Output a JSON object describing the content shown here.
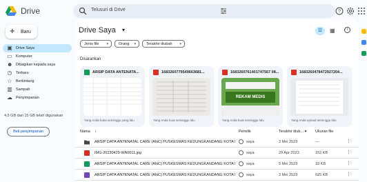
{
  "app": {
    "title": "Drive",
    "brand_colors": [
      "#4285f4",
      "#0f9d58",
      "#fbbc04"
    ]
  },
  "search": {
    "placeholder": "Telusuri di Drive",
    "icon": "search-icon"
  },
  "topbar": {
    "icons": [
      "tune-icon",
      "help-icon",
      "settings-icon",
      "apps-icon"
    ]
  },
  "sidebar": {
    "new_label": "Baru",
    "items": [
      {
        "label": "Drive Saya",
        "icon": "my-drive-icon",
        "active": true
      },
      {
        "label": "Komputer",
        "icon": "computer-icon"
      },
      {
        "label": "Dibagikan kepada saya",
        "icon": "shared-icon"
      },
      {
        "label": "Terbaru",
        "icon": "clock-icon"
      },
      {
        "label": "Berbintang",
        "icon": "star-icon"
      },
      {
        "label": "Sampah",
        "icon": "trash-icon"
      },
      {
        "label": "Penyimpanan",
        "icon": "cloud-icon"
      }
    ],
    "storage_text": "4,5 GB dari 15 GB telah digunakan",
    "storage_used_fraction": 0.3,
    "buy_label": "Beli penyimpanan"
  },
  "main": {
    "title": "Drive Saya",
    "filters": [
      "Jenis file",
      "Orang",
      "Terakhir diubah"
    ],
    "suggested_label": "Disarankan",
    "cards": [
      {
        "name": "ARSIP DATA ANTENATA...",
        "sub": "Yang Anda buka seminggu yang lalu",
        "type": "sheet",
        "color": "#0f9d58"
      },
      {
        "name": "1683260779549663681...",
        "sub": "Yang Anda buat seminggu lalu",
        "type": "image",
        "color": "#d93025"
      },
      {
        "name": "1683260761401747567 08...",
        "sub": "Yang Anda buat seminggu lalu",
        "type": "image",
        "color": "#d93025",
        "thumb_text": "REKAM MEDIS"
      },
      {
        "name": "1683260478472927204...",
        "sub": "Yang Anda upload seminggu lalu",
        "type": "image",
        "color": "#d93025"
      }
    ],
    "columns": {
      "name": "Nama",
      "owner": "Pemilik",
      "modified": "Terakhir diub...",
      "size": "Ukuran file"
    },
    "rows": [
      {
        "name": "ARSIP DATA ANTENATAL CARE (ANC) PUSKESMAS KEDUNGKANDANG KOTA M...",
        "owner": "saya",
        "date": "3 Mei 2023",
        "size": "—",
        "type": "folder",
        "color": "#444746"
      },
      {
        "name": "IMG-20230429-WA0011.jpg",
        "owner": "saya",
        "date": "29 Apr 2023",
        "size": "152 KB",
        "type": "image",
        "color": "#d93025"
      },
      {
        "name": "ARSIP DATA ANTENATAL CARE (ANC) PUSKESMAS KEDUNGKANDANG KOTA M...",
        "owner": "saya",
        "date": "5 Mei 2023",
        "size": "19 KB",
        "type": "sheet",
        "color": "#0f9d58"
      },
      {
        "name": "ARSIP DATA ANTENATAL CARE (ANC) PUSKESMAS KEDUNGKANDANG KOTA M...",
        "owner": "saya",
        "date": "3 Mei 2023",
        "size": "625 KB",
        "type": "form",
        "color": "#7248b9"
      }
    ]
  }
}
